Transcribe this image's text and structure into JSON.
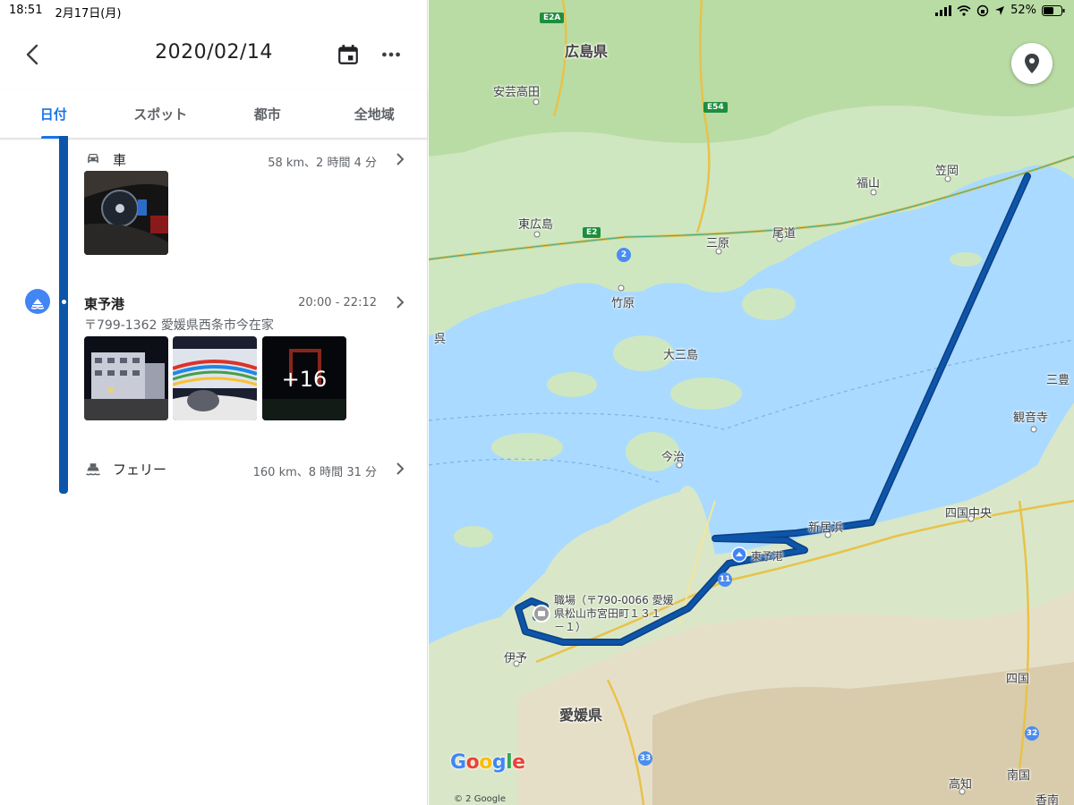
{
  "status": {
    "time": "18:51",
    "date": "2月17日(月)",
    "battery": "52%"
  },
  "header": {
    "title": "2020/02/14"
  },
  "tabs": [
    {
      "label": "日付",
      "active": true
    },
    {
      "label": "スポット",
      "active": false
    },
    {
      "label": "都市",
      "active": false
    },
    {
      "label": "全地域",
      "active": false
    }
  ],
  "timeline": {
    "car": {
      "label": "車",
      "meta": "58 km、2 時間 4 分",
      "icon": "car-icon"
    },
    "place": {
      "name": "東予港",
      "time": "20:00 - 22:12",
      "address": "〒799-1362 愛媛県西条市今在家",
      "more_photos": "+16",
      "icon": "ferry-port-icon"
    },
    "ferry": {
      "label": "フェリー",
      "meta": "160 km、8 時間 31 分",
      "icon": "ferry-icon"
    }
  },
  "map": {
    "labels": {
      "hiroshima": "広島県",
      "akitakata": "安芸高田",
      "higashihiroshima": "東広島",
      "mihara": "三原",
      "onomichi": "尾道",
      "fukuyama": "福山",
      "kasaoka": "笠岡",
      "takehara": "竹原",
      "kure": "呉",
      "omishima": "大三島",
      "imabari": "今治",
      "niihama": "新居浜",
      "toyo_port": "東予港",
      "shikokuchuo": "四国中央",
      "kanonji": "観音寺",
      "mitoyo": "三豊",
      "iyo": "伊予",
      "ehime": "愛媛県",
      "shikoku": "四国",
      "kochi": "高知",
      "nankoku": "南国",
      "kami": "香南",
      "work_place": "職場（〒790-0066 愛媛県松山市宮田町１３１－１）",
      "work_line1": "職場（〒790-0066 愛媛",
      "work_line2": "県松山市宮田町１３１",
      "work_line3": "－１）"
    },
    "roads": {
      "e2a": "E2A",
      "e54": "E54",
      "e2": "E2",
      "r2": "2",
      "r11": "11",
      "r33": "33",
      "r32": "32"
    },
    "google": "Google",
    "copyright": "©   2 Google",
    "colors": {
      "water": "#aadaff",
      "route": "#0d55a8",
      "accent": "#1a73e8"
    }
  }
}
